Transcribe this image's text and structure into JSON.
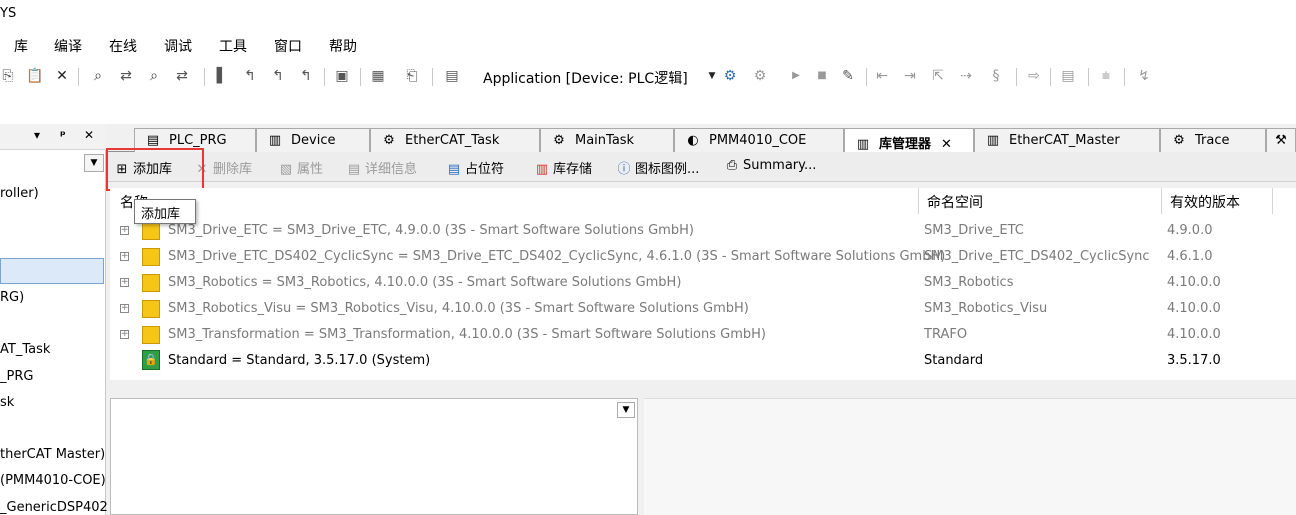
{
  "title": "YS",
  "menu": [
    "库",
    "编译",
    "在线",
    "调试",
    "工具",
    "窗口",
    "帮助"
  ],
  "toolbar": {
    "application_combo": "Application [Device: PLC逻辑]",
    "icons": [
      "copy-icon",
      "paste-icon",
      "delete-icon",
      "find-icon",
      "replace-icon",
      "find-next-icon",
      "bookmark-icon"
    ]
  },
  "left_panel": {
    "controls": [
      "▾",
      "ᵖ",
      "✕"
    ],
    "tree": [
      "roller)",
      "RG)",
      "AT_Task",
      "_PRG",
      "sk",
      "therCAT Master)",
      "(PMM4010-COE)",
      "_GenericDSP402 ("
    ]
  },
  "tabs": [
    {
      "label": "PLC_PRG",
      "icon": "program-icon"
    },
    {
      "label": "Device",
      "icon": "device-icon"
    },
    {
      "label": "EtherCAT_Task",
      "icon": "task-icon"
    },
    {
      "label": "MainTask",
      "icon": "task-icon"
    },
    {
      "label": "PMM4010_COE",
      "icon": "drive-icon"
    },
    {
      "label": "库管理器",
      "icon": "library-icon",
      "active": true
    },
    {
      "label": "EtherCAT_Master",
      "icon": "device-icon"
    },
    {
      "label": "Trace",
      "icon": "trace-icon"
    }
  ],
  "lib_toolbar": {
    "add_library": "添加库",
    "delete_library": "删除库",
    "properties": "属性",
    "details": "详细信息",
    "placeholder": "占位符",
    "library_repository": "库存储",
    "icon_legend": "图标图例...",
    "summary": "Summary..."
  },
  "tooltip": "添加库",
  "table": {
    "headers": {
      "name": "名称",
      "namespace": "命名空间",
      "effective_version": "有效的版本"
    },
    "rows": [
      {
        "name": "SM3_Drive_ETC = SM3_Drive_ETC, 4.9.0.0 (3S - Smart Software Solutions GmbH)",
        "namespace": "SM3_Drive_ETC",
        "version": "4.9.0.0",
        "style": "grey"
      },
      {
        "name": "SM3_Drive_ETC_DS402_CyclicSync = SM3_Drive_ETC_DS402_CyclicSync, 4.6.1.0 (3S - Smart Software Solutions GmbH)",
        "namespace": "SM3_Drive_ETC_DS402_CyclicSync",
        "version": "4.6.1.0",
        "style": "grey"
      },
      {
        "name": "SM3_Robotics = SM3_Robotics, 4.10.0.0 (3S - Smart Software Solutions GmbH)",
        "namespace": "SM3_Robotics",
        "version": "4.10.0.0",
        "style": "grey"
      },
      {
        "name": "SM3_Robotics_Visu = SM3_Robotics_Visu, 4.10.0.0 (3S - Smart Software Solutions GmbH)",
        "namespace": "SM3_Robotics_Visu",
        "version": "4.10.0.0",
        "style": "grey"
      },
      {
        "name": "SM3_Transformation = SM3_Transformation, 4.10.0.0 (3S - Smart Software Solutions GmbH)",
        "namespace": "TRAFO",
        "version": "4.10.0.0",
        "style": "grey"
      },
      {
        "name": "Standard = Standard, 3.5.17.0 (System)",
        "namespace": "Standard",
        "version": "3.5.17.0",
        "style": "normal"
      }
    ]
  },
  "colors": {
    "highlight": "#e53935",
    "selection": "#dbe9f8"
  }
}
